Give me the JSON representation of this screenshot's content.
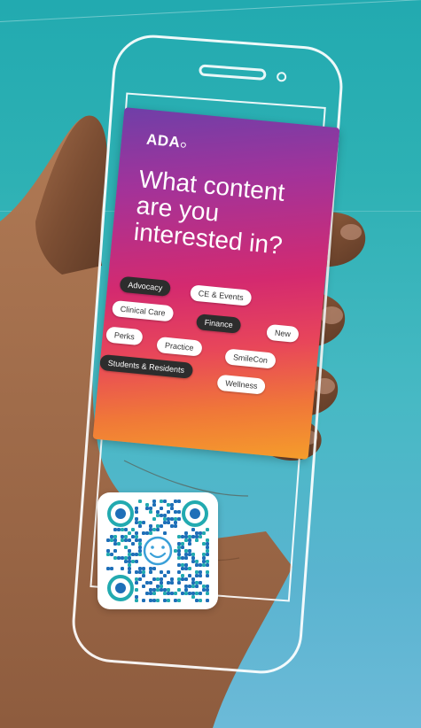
{
  "card": {
    "logo": "ADA",
    "headline": "What content\nare you\ninterested in?",
    "topics": [
      {
        "label": "Advocacy",
        "style": "dark"
      },
      {
        "label": "CE & Events",
        "style": "light"
      },
      {
        "label": "Clinical Care",
        "style": "light"
      },
      {
        "label": "Finance",
        "style": "dark"
      },
      {
        "label": "New",
        "style": "light"
      },
      {
        "label": "Perks",
        "style": "light"
      },
      {
        "label": "Practice",
        "style": "light"
      },
      {
        "label": "SmileCon",
        "style": "light"
      },
      {
        "label": "Students & Residents",
        "style": "dark"
      },
      {
        "label": "Wellness",
        "style": "light"
      }
    ]
  },
  "colors": {
    "background_top": "#22aab0",
    "background_bottom": "#6cbad8",
    "card_gradient_start": "#6f3fa8",
    "card_gradient_mid": "#d42a6f",
    "card_gradient_end": "#f59d2b",
    "qr_primary": "#1e6fb8",
    "qr_secondary": "#22aab0",
    "skin": "#8a5a3c"
  },
  "icons": {
    "qr_center": "smiley-face-icon"
  }
}
